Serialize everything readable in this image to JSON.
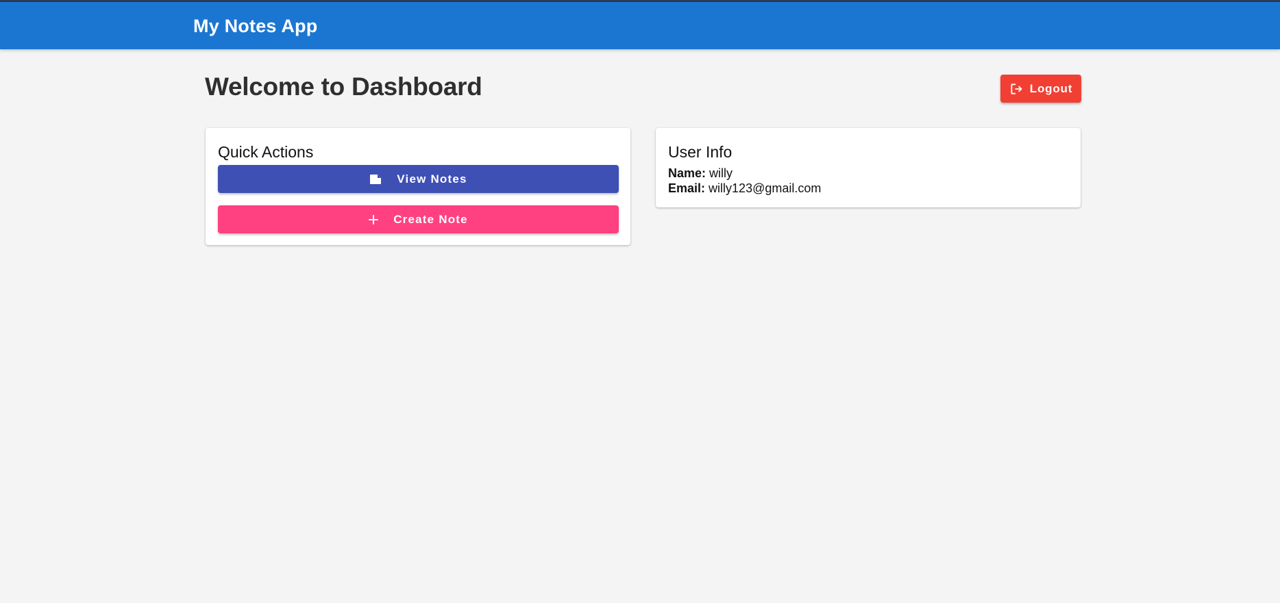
{
  "header": {
    "app_title": "My Notes App"
  },
  "main": {
    "page_title": "Welcome to Dashboard",
    "logout_label": "Logout"
  },
  "quick_actions": {
    "title": "Quick Actions",
    "view_notes_label": "View Notes",
    "create_note_label": "Create Note"
  },
  "user_info": {
    "title": "User Info",
    "name_label": "Name:",
    "name_value": "willy",
    "email_label": "Email:",
    "email_value": "willy123@gmail.com"
  },
  "colors": {
    "appbar": "#1b76d2",
    "logout": "#f23f33",
    "view_notes": "#3f50b5",
    "create_note": "#ff4081",
    "background": "#f4f4f4"
  },
  "icons": {
    "logout": "logout-icon",
    "view_notes": "note-icon",
    "create_note": "plus-icon"
  }
}
